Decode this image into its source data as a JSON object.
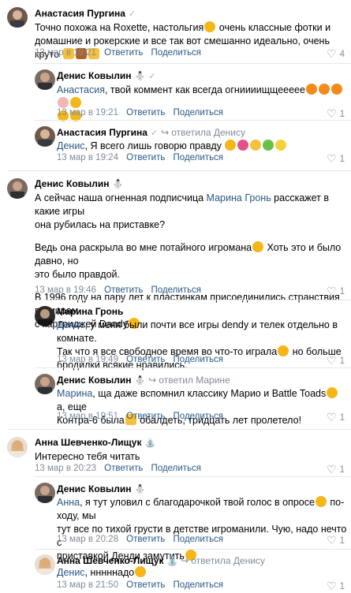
{
  "actions": {
    "reply": "Ответить",
    "share": "Поделиться"
  },
  "comments": [
    {
      "author": "Анастасия Пургина",
      "text": "Точно похожа на Roxette, настольгия",
      "text2": " очень классные фотки и домашние и рокерские и все так вот смешанно идеально, очень круто",
      "date": "13 мар в 19:21",
      "likes": "4"
    },
    {
      "author": "Денис Ковылин",
      "mention": "Анастасия",
      "text": ", твой коммент как всегда огниииищщеееее",
      "date": "13 мар в 19:21",
      "likes": "1"
    },
    {
      "author": "Анастасия Пургина",
      "reply_to": "ответила Денису",
      "mention": "Денис",
      "text": ", Я всего лишь говорю правду",
      "date": "13 мар в 19:24",
      "likes": "1"
    },
    {
      "author": "Денис Ковылин",
      "line1a": "А сейчас наша огненная подписчица ",
      "mention": "Марина Гронь",
      "line1b": " расскажет в какие игры",
      "line2": "она рубилась на приставке?",
      "line3": "Ведь она раскрыла во мне потайного игромана",
      "line3b": " Хоть это и было давно, но",
      "line4": "это было правдой.",
      "line5": "В 1996 году на пару лет к пластинкам присоединились странствия по мирам",
      "line6": "с картриджей Dandy",
      "date": "13 мар в 19:46",
      "likes": "1"
    },
    {
      "author": "Марина Гронь",
      "mention": "Денис",
      "line1": ", у меня были почти все игры dendy и телек отдельно в комнате.",
      "line2": "Так что я все свободное время во что-то играла",
      "line2b": " но больше",
      "line3": "бродилки всякие нравились.",
      "date": "13 мар в 19:49",
      "likes": "1"
    },
    {
      "author": "Денис Ковылин",
      "reply_to": "ответил Марине",
      "mention": "Марина",
      "line1": ", ща даже вспомнил классику Марио и Battle Toads",
      "line1b": " а, еще",
      "line2": "Контра-6 была",
      "line2b": " обалдеть, тридцать лет пролетело!",
      "date": "13 мар в 19:51",
      "likes": "1"
    },
    {
      "author": "Анна Шевченко-Лищук",
      "text": "Интересно тебя читать",
      "date": "13 мар в 20:23",
      "likes": "1"
    },
    {
      "author": "Денис Ковылин",
      "mention": "Анна",
      "line1": ", я тут уловил с благодарочкой твой голос в опросе",
      "line1b": " по-ходу, мы",
      "line2": "тут все по тихой грусти в детстве игроманили. Чую, надо нечто с",
      "line3": "приставкой Денди замутить",
      "date": "13 мар в 20:28",
      "likes": "1"
    },
    {
      "author": "Анна Шевченко-Лищук",
      "reply_to": "ответила Денису",
      "mention": "Денис",
      "text": ", нннннадо",
      "date": "13 мар в 21:50",
      "likes": "1"
    }
  ],
  "colors": {
    "link": "#2a5885",
    "meta": "#818c99",
    "emoji": "#f5b61a",
    "divider": "#e7e8ec"
  }
}
